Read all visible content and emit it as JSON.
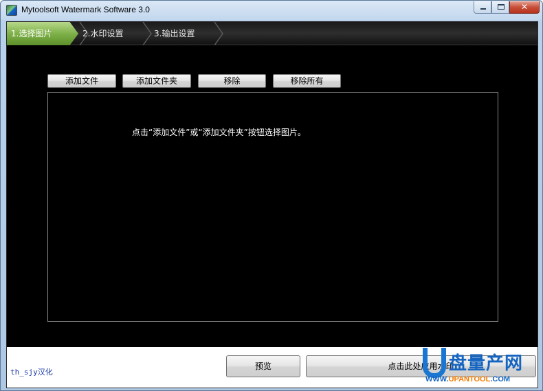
{
  "window": {
    "title": "Mytoolsoft Watermark Software 3.0",
    "close_glyph": "✕",
    "icons": [
      "app-icon",
      "minimize-icon",
      "maximize-icon",
      "close-icon"
    ]
  },
  "steps": [
    {
      "label": "1.选择图片",
      "active": true
    },
    {
      "label": "2.水印设置",
      "active": false
    },
    {
      "label": "3.输出设置",
      "active": false
    }
  ],
  "toolbar": {
    "add_file": "添加文件",
    "add_folder": "添加文件夹",
    "remove": "移除",
    "remove_all": "移除所有"
  },
  "list": {
    "hint": "点击“添加文件”或“添加文件夹”按钮选择图片。"
  },
  "footer": {
    "credit": "th_sjy汉化",
    "preview": "预览",
    "process": "点击此处应用水印"
  },
  "watermark": {
    "brand": "盘量产网",
    "url_prefix": "WWW.",
    "url_main": "UPANTOOL",
    "url_suffix": ".COM"
  },
  "colors": {
    "active_step": "#7fb14a",
    "client_bg": "#000000",
    "credit_text": "#1a3aa8",
    "watermark_blue": "#1565c0"
  }
}
